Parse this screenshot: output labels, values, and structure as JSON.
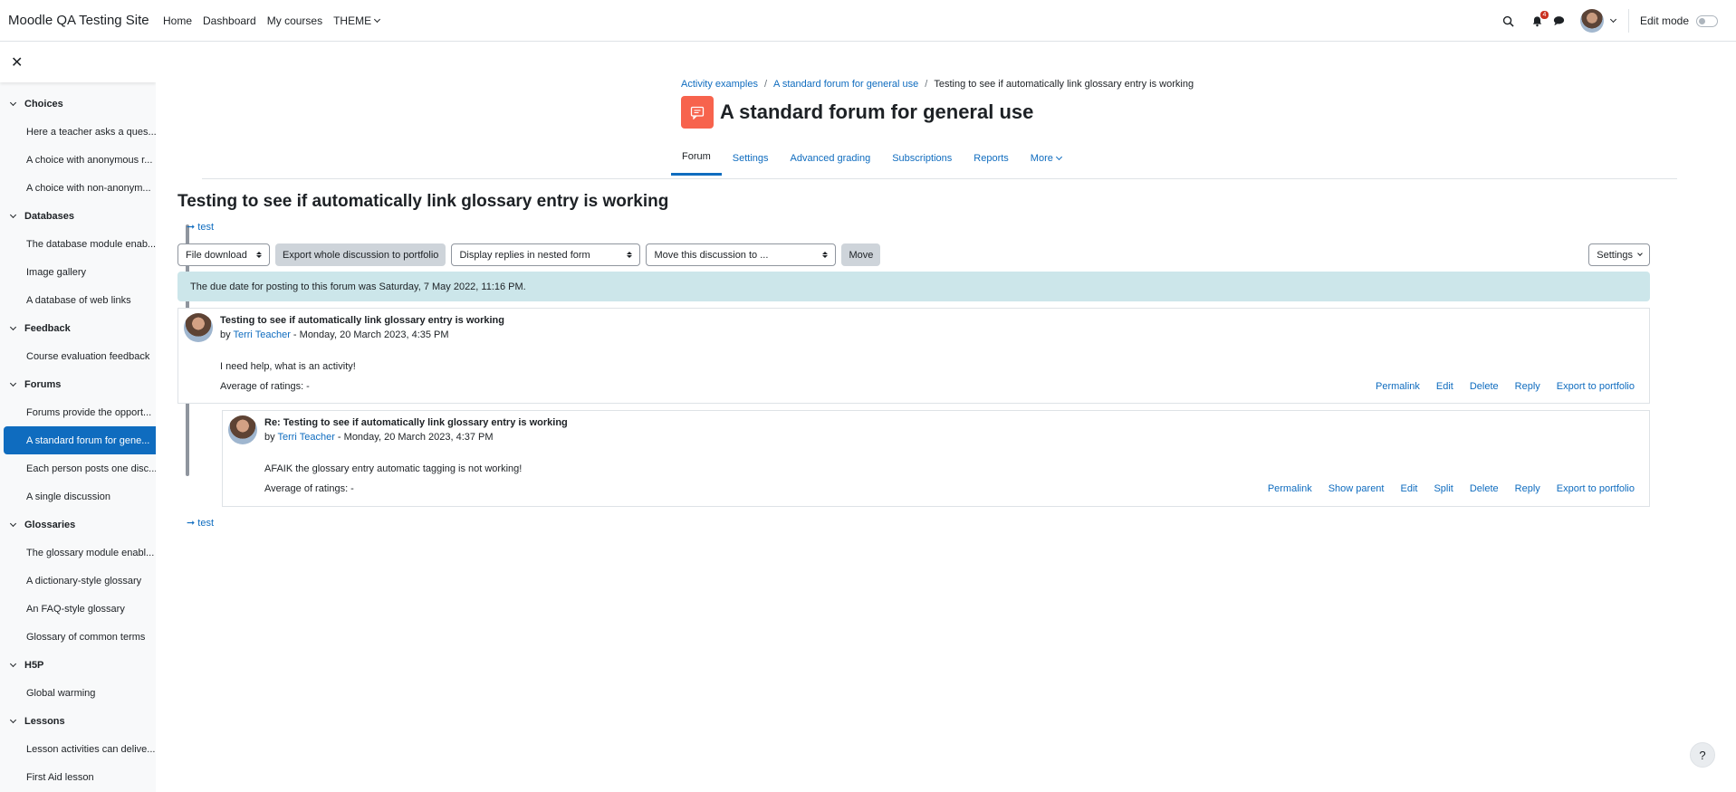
{
  "navbar": {
    "site_name": "Moodle QA Testing Site",
    "items": [
      {
        "label": "Home"
      },
      {
        "label": "Dashboard"
      },
      {
        "label": "My courses"
      },
      {
        "label": "THEME"
      }
    ],
    "notification_count": "4",
    "edit_mode_label": "Edit mode"
  },
  "drawer": {
    "sections": [
      {
        "title": "Choices",
        "items": [
          "Here a teacher asks a ques...",
          "A choice with anonymous r...",
          "A choice with non-anonym..."
        ]
      },
      {
        "title": "Databases",
        "items": [
          "The database module enab...",
          "Image gallery",
          "A database of web links"
        ]
      },
      {
        "title": "Feedback",
        "items": [
          "Course evaluation feedback"
        ]
      },
      {
        "title": "Forums",
        "items": [
          "Forums provide the opport...",
          "A standard forum for gene...",
          "Each person posts one disc...",
          "A single discussion"
        ]
      },
      {
        "title": "Glossaries",
        "items": [
          "The glossary module enabl...",
          "A dictionary-style glossary",
          "An FAQ-style glossary",
          "Glossary of common terms"
        ]
      },
      {
        "title": "H5P",
        "items": [
          "Global warming"
        ]
      },
      {
        "title": "Lessons",
        "items": [
          "Lesson activities can delive...",
          "First Aid lesson"
        ]
      }
    ]
  },
  "breadcrumb": {
    "items": [
      "Activity examples",
      "A standard forum for general use",
      "Testing to see if automatically link glossary entry is working"
    ]
  },
  "page": {
    "title": "A standard forum for general use"
  },
  "tabs": [
    "Forum",
    "Settings",
    "Advanced grading",
    "Subscriptions",
    "Reports",
    "More"
  ],
  "discussion": {
    "title": "Testing to see if automatically link glossary entry is working",
    "nav_link": "➞ test",
    "toolbar": {
      "file_download": "File download",
      "export_button": "Export whole discussion to portfolio",
      "display_mode": "Display replies in nested form",
      "move_select": "Move this discussion to ...",
      "move_button": "Move",
      "settings_button": "Settings"
    },
    "alert": "The due date for posting to this forum was Saturday, 7 May 2022, 11:16 PM.",
    "posts": [
      {
        "subject": "Testing to see if automatically link glossary entry is working",
        "by_prefix": "by",
        "author": "Terri Teacher",
        "date": " - Monday, 20 March 2023, 4:35 PM",
        "body": "I need help, what is an activity!",
        "rating": "Average of ratings: -",
        "actions": [
          "Permalink",
          "Edit",
          "Delete",
          "Reply",
          "Export to portfolio"
        ]
      },
      {
        "subject": "Re: Testing to see if automatically link glossary entry is working",
        "by_prefix": "by",
        "author": "Terri Teacher",
        "date": " - Monday, 20 March 2023, 4:37 PM",
        "body": "AFAIK the glossary entry automatic tagging is not working!",
        "rating": "Average of ratings: -",
        "actions": [
          "Permalink",
          "Show parent",
          "Edit",
          "Split",
          "Delete",
          "Reply",
          "Export to portfolio"
        ]
      }
    ]
  },
  "help_label": "?"
}
